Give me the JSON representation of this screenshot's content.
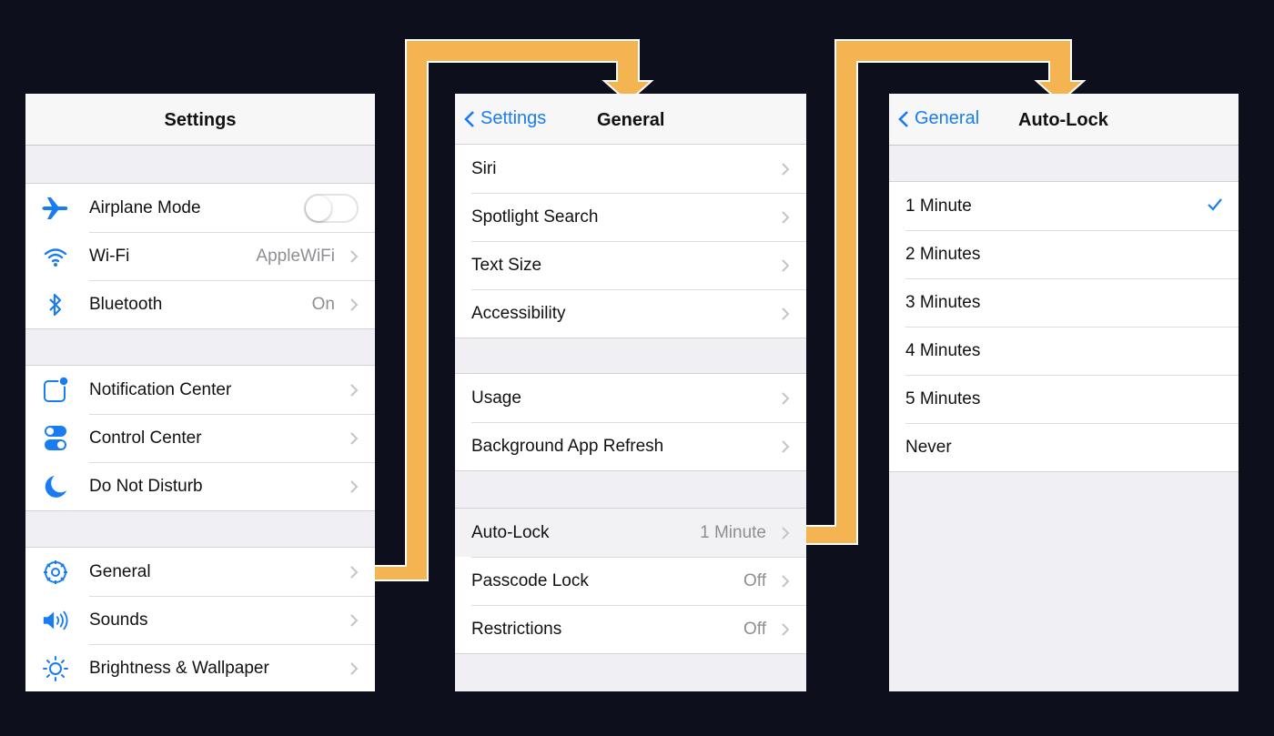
{
  "colors": {
    "accent": "#1a7cf2",
    "arrow": "#f4b451",
    "background": "#0e0f1c"
  },
  "settings": {
    "title": "Settings",
    "groups": [
      [
        {
          "label": "Airplane Mode",
          "icon": "airplane-icon",
          "control": "toggle",
          "toggle_on": false
        },
        {
          "label": "Wi-Fi",
          "icon": "wifi-icon",
          "value": "AppleWiFi"
        },
        {
          "label": "Bluetooth",
          "icon": "bluetooth-icon",
          "value": "On"
        }
      ],
      [
        {
          "label": "Notification Center",
          "icon": "notification-center-icon"
        },
        {
          "label": "Control Center",
          "icon": "control-center-icon"
        },
        {
          "label": "Do Not Disturb",
          "icon": "moon-icon"
        }
      ],
      [
        {
          "label": "General",
          "icon": "gear-icon"
        },
        {
          "label": "Sounds",
          "icon": "speaker-icon"
        },
        {
          "label": "Brightness & Wallpaper",
          "icon": "brightness-icon"
        }
      ]
    ]
  },
  "general": {
    "back": "Settings",
    "title": "General",
    "groups": [
      [
        {
          "label": "Siri"
        },
        {
          "label": "Spotlight Search"
        },
        {
          "label": "Text Size"
        },
        {
          "label": "Accessibility"
        }
      ],
      [
        {
          "label": "Usage"
        },
        {
          "label": "Background App Refresh"
        }
      ],
      [
        {
          "label": "Auto-Lock",
          "value": "1 Minute"
        },
        {
          "label": "Passcode Lock",
          "value": "Off"
        },
        {
          "label": "Restrictions",
          "value": "Off"
        }
      ]
    ]
  },
  "autolock": {
    "back": "General",
    "title": "Auto-Lock",
    "options": [
      {
        "label": "1 Minute",
        "selected": true
      },
      {
        "label": "2 Minutes"
      },
      {
        "label": "3 Minutes"
      },
      {
        "label": "4 Minutes"
      },
      {
        "label": "5 Minutes"
      },
      {
        "label": "Never"
      }
    ]
  }
}
